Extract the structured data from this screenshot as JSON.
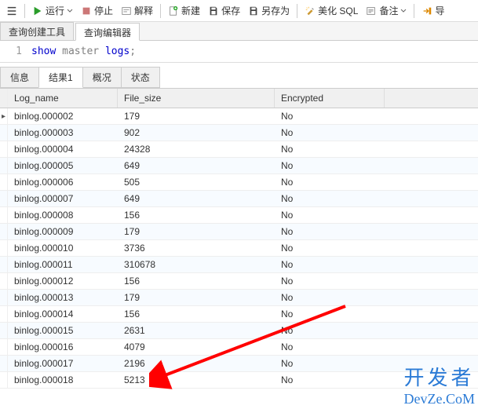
{
  "toolbar": {
    "run": "运行",
    "stop": "停止",
    "explain": "解释",
    "new": "新建",
    "save": "保存",
    "save_as": "另存为",
    "beautify": "美化 SQL",
    "notes": "备注"
  },
  "top_tabs": {
    "builder": "查询创建工具",
    "editor": "查询编辑器"
  },
  "sql": {
    "line_no": "1",
    "text_show": "show",
    "text_master": "master",
    "text_logs": "logs",
    "semi": ";"
  },
  "mid_tabs": {
    "info": "信息",
    "result1": "结果1",
    "profile": "概况",
    "status": "状态"
  },
  "grid": {
    "headers": {
      "log_name": "Log_name",
      "file_size": "File_size",
      "encrypted": "Encrypted"
    },
    "rows": [
      {
        "name": "binlog.000002",
        "size": "179",
        "enc": "No",
        "current": true
      },
      {
        "name": "binlog.000003",
        "size": "902",
        "enc": "No"
      },
      {
        "name": "binlog.000004",
        "size": "24328",
        "enc": "No"
      },
      {
        "name": "binlog.000005",
        "size": "649",
        "enc": "No"
      },
      {
        "name": "binlog.000006",
        "size": "505",
        "enc": "No"
      },
      {
        "name": "binlog.000007",
        "size": "649",
        "enc": "No"
      },
      {
        "name": "binlog.000008",
        "size": "156",
        "enc": "No"
      },
      {
        "name": "binlog.000009",
        "size": "179",
        "enc": "No"
      },
      {
        "name": "binlog.000010",
        "size": "3736",
        "enc": "No"
      },
      {
        "name": "binlog.000011",
        "size": "310678",
        "enc": "No"
      },
      {
        "name": "binlog.000012",
        "size": "156",
        "enc": "No"
      },
      {
        "name": "binlog.000013",
        "size": "179",
        "enc": "No"
      },
      {
        "name": "binlog.000014",
        "size": "156",
        "enc": "No"
      },
      {
        "name": "binlog.000015",
        "size": "2631",
        "enc": "No"
      },
      {
        "name": "binlog.000016",
        "size": "4079",
        "enc": "No"
      },
      {
        "name": "binlog.000017",
        "size": "2196",
        "enc": "No"
      },
      {
        "name": "binlog.000018",
        "size": "5213",
        "enc": "No"
      }
    ]
  },
  "watermark": {
    "line1": "开发者",
    "line2": "DevZe.CoM"
  }
}
